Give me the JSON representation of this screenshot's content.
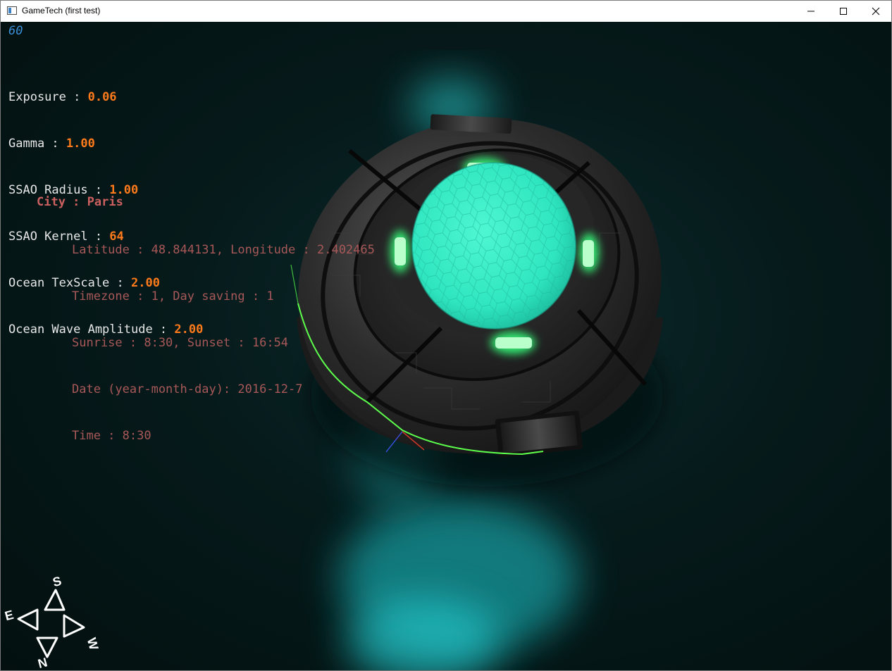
{
  "window": {
    "title": "GameTech (first test)",
    "controls": {
      "minimize": "minimize-icon",
      "maximize": "maximize-icon",
      "close": "close-icon"
    }
  },
  "hud": {
    "fps": "60",
    "settings": [
      {
        "label": "Exposure : ",
        "value": "0.06"
      },
      {
        "label": "Gamma : ",
        "value": "1.00"
      },
      {
        "label": "SSAO Radius : ",
        "value": "1.00"
      },
      {
        "label": "SSAO Kernel : ",
        "value": "64"
      },
      {
        "label": "Ocean TexScale : ",
        "value": "2.00"
      },
      {
        "label": "Ocean Wave Amplitude : ",
        "value": "2.00"
      }
    ],
    "city": {
      "title": "City : Paris",
      "latitude": "Latitude : 48.844131, Longitude : 2.402465",
      "timezone": "Timezone : 1, Day saving : 1",
      "sun": "Sunrise : 8:30, Sunset : 16:54",
      "date": "Date (year-month-day): 2016-12-7",
      "time": "Time : 8:30"
    }
  },
  "compass": {
    "north": "N",
    "south": "S",
    "east": "E",
    "west": "W"
  },
  "colors": {
    "background": "#061a1b",
    "dome": "#35f0c8",
    "lights": "#36ff7a",
    "outline": "#5cff4c",
    "value": "#ff7a1a",
    "city_text": "#a85858"
  }
}
